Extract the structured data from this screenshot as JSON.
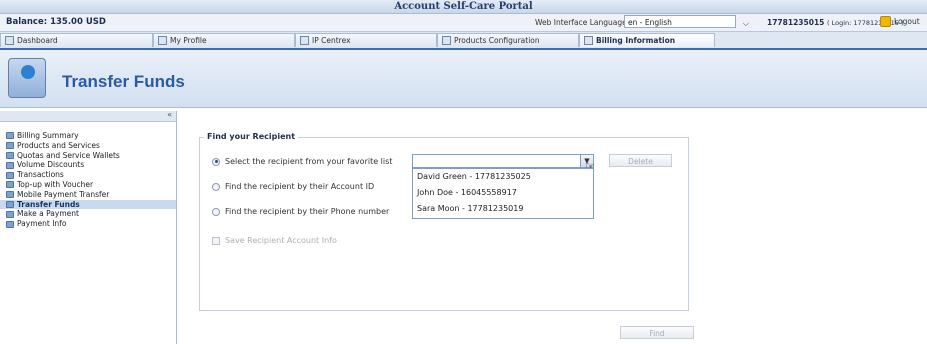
{
  "window": {
    "title": "Account Self-Care Portal"
  },
  "infobar": {
    "balance": "Balance: 135.00 USD",
    "language_label": "Web Interface Language:",
    "language_value": "en - English",
    "account_id": "17781235015",
    "login_text": "( Login: 17781235015 )",
    "logout_label": "Logout"
  },
  "tabs": [
    {
      "label": "Dashboard",
      "icon": "dashboard-icon"
    },
    {
      "label": "My Profile",
      "icon": "profile-icon"
    },
    {
      "label": "IP Centrex",
      "icon": "ip-centrex-icon"
    },
    {
      "label": "Products Configuration",
      "icon": "products-config-icon"
    },
    {
      "label": "Billing Information",
      "icon": "billing-icon"
    }
  ],
  "header": {
    "title": "Transfer Funds",
    "icon": "transfer-funds-icon"
  },
  "sidebar": {
    "collapse_icon": "«",
    "items": [
      {
        "label": "Billing Summary"
      },
      {
        "label": "Products and Services"
      },
      {
        "label": "Quotas and Service Wallets"
      },
      {
        "label": "Volume Discounts"
      },
      {
        "label": "Transactions"
      },
      {
        "label": "Top-up with Voucher"
      },
      {
        "label": "Mobile Payment Transfer"
      },
      {
        "label": "Transfer Funds"
      },
      {
        "label": "Make a Payment"
      },
      {
        "label": "Payment Info"
      }
    ]
  },
  "form": {
    "legend": "Find your Recipient",
    "options": [
      {
        "label": "Select the recipient from your favorite list",
        "selected": true
      },
      {
        "label": "Find the recipient by their Account ID",
        "selected": false
      },
      {
        "label": "Find the recipient by their Phone number",
        "selected": false
      }
    ],
    "save_label": "Save Recipient Account Info",
    "combo_value": "",
    "dropdown_items": [
      "David Green - 17781235025",
      "John Doe - 16045558917",
      "Sara Moon - 17781235019"
    ],
    "delete_label": "Delete",
    "find_label": "Find"
  }
}
